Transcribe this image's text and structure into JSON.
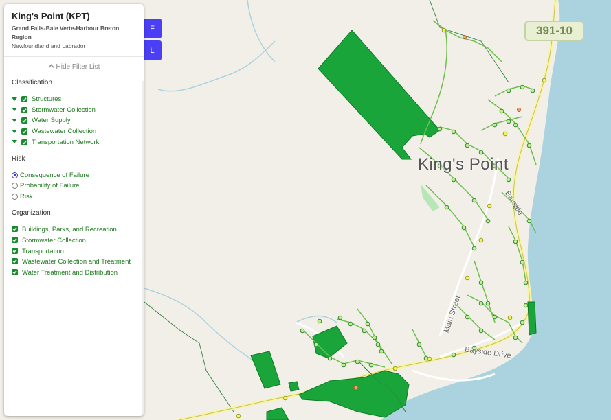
{
  "panel": {
    "title": "King's Point (KPT)",
    "region": "Grand Falls-Baie Verte-Harbour Breton Region",
    "province": "Newfoundland and Labrador",
    "hide_label": "Hide Filter List"
  },
  "classification": {
    "title": "Classification",
    "items": [
      "Structures",
      "Stormwater Collection",
      "Water Supply",
      "Wastewater Collection",
      "Transportation Network"
    ]
  },
  "risk": {
    "title": "Risk",
    "options": [
      "Consequence of Failure",
      "Probability of Failure",
      "Risk"
    ],
    "selected": "Consequence of Failure"
  },
  "organization": {
    "title": "Organization",
    "items": [
      "Buildings, Parks, and Recreation",
      "Stormwater Collection",
      "Transportation",
      "Wastewater Collection and Treatment",
      "Water Treatment and Distribution"
    ]
  },
  "buttons": {
    "f": "F",
    "l": "L"
  },
  "map": {
    "route_shield": "391-10",
    "place_label": "King's Point",
    "street_main": "Main Street",
    "street_bayside": "Bayside Drive",
    "street_side": "Bayside",
    "colors": {
      "land": "#f2efe9",
      "water": "#aad3df",
      "asset": "#1aa53a",
      "accent": "#4b3ff5"
    }
  }
}
